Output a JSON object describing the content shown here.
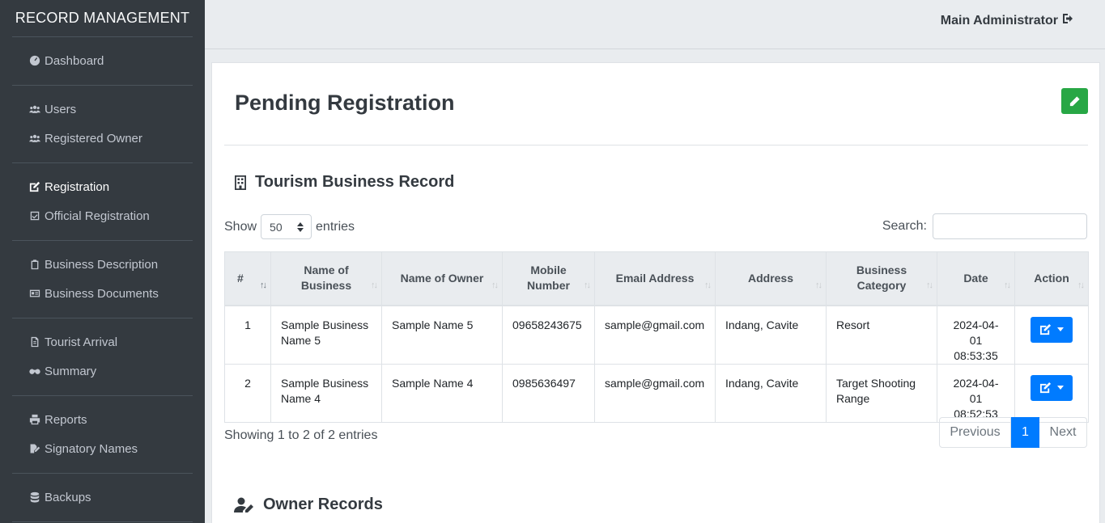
{
  "sidebar": {
    "brand": "RECORD MANAGEMENT",
    "groups": [
      [
        {
          "label": "Dashboard",
          "icon": "tachometer-icon"
        }
      ],
      [
        {
          "label": "Users",
          "icon": "users-icon"
        },
        {
          "label": "Registered Owner",
          "icon": "users-icon"
        }
      ],
      [
        {
          "label": "Registration",
          "icon": "edit-icon",
          "active": true
        },
        {
          "label": "Official Registration",
          "icon": "check-square-icon"
        }
      ],
      [
        {
          "label": "Business Description",
          "icon": "clipboard-icon"
        },
        {
          "label": "Business Documents",
          "icon": "id-card-icon"
        }
      ],
      [
        {
          "label": "Tourist Arrival",
          "icon": "file-icon"
        },
        {
          "label": "Summary",
          "icon": "binoculars-icon"
        }
      ],
      [
        {
          "label": "Reports",
          "icon": "print-icon"
        },
        {
          "label": "Signatory Names",
          "icon": "file-signature-icon"
        }
      ],
      [
        {
          "label": "Backups",
          "icon": "database-icon"
        }
      ]
    ]
  },
  "header": {
    "user": "Main Administrator"
  },
  "main": {
    "title": "Pending Registration",
    "section1": "Tourism Business Record",
    "section2": "Owner Records",
    "show_label": "Show",
    "entries_label": "entries",
    "page_size": "50",
    "search_label": "Search:",
    "columns": [
      "#",
      "Name of Business",
      "Name of Owner",
      "Mobile Number",
      "Email Address",
      "Address",
      "Business Category",
      "Date",
      "Action"
    ],
    "rows": [
      {
        "num": "1",
        "business": "Sample Business Name 5",
        "owner": "Sample Name 5",
        "mobile": "09658243675",
        "email": "sample@gmail.com",
        "address": "Indang, Cavite",
        "category": "Resort",
        "date": "2024-04-01 08:53:35"
      },
      {
        "num": "2",
        "business": "Sample Business Name 4",
        "owner": "Sample Name 4",
        "mobile": "0985636497",
        "email": "sample@gmail.com",
        "address": "Indang, Cavite",
        "category": "Target Shooting Range",
        "date": "2024-04-01 08:52:53"
      }
    ],
    "info": "Showing 1 to 2 of 2 entries",
    "pagination": {
      "prev": "Previous",
      "current": "1",
      "next": "Next"
    }
  },
  "colors": {
    "sidebar": "#343a40",
    "primary": "#007bff",
    "success": "#28a745"
  }
}
